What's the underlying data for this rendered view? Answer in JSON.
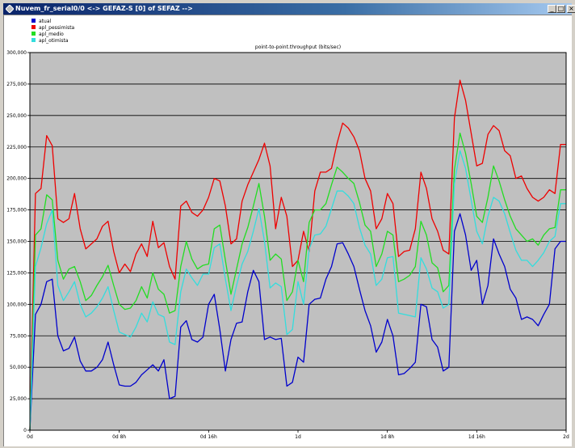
{
  "window": {
    "title": "Nuvem_fr_serial0/0 <-> GEFAZ-S [0] of SEFAZ -->",
    "minimize_icon": "minimize-icon",
    "maximize_icon": "maximize-icon",
    "close_icon": "close-icon"
  },
  "chart_data": {
    "type": "line",
    "title": "point-to-point.throughput (bits/sec)",
    "ylim": [
      0,
      300000
    ],
    "xlim": [
      0,
      96
    ],
    "y_ticks": [
      {
        "value": 0,
        "label": "0"
      },
      {
        "value": 25000,
        "label": "25,000"
      },
      {
        "value": 50000,
        "label": "50,000"
      },
      {
        "value": 75000,
        "label": "75,000"
      },
      {
        "value": 100000,
        "label": "100,000"
      },
      {
        "value": 125000,
        "label": "125,000"
      },
      {
        "value": 150000,
        "label": "150,000"
      },
      {
        "value": 175000,
        "label": "175,000"
      },
      {
        "value": 200000,
        "label": "200,000"
      },
      {
        "value": 225000,
        "label": "225,000"
      },
      {
        "value": 250000,
        "label": "250,000"
      },
      {
        "value": 275000,
        "label": "275,000"
      },
      {
        "value": 300000,
        "label": "300,000"
      }
    ],
    "x_ticks": [
      {
        "value": 0,
        "label": "0d"
      },
      {
        "value": 16,
        "label": "0d 8h"
      },
      {
        "value": 32,
        "label": "0d 16h"
      },
      {
        "value": 48,
        "label": "1d"
      },
      {
        "value": 64,
        "label": "1d 8h"
      },
      {
        "value": 80,
        "label": "1d 16h"
      },
      {
        "value": 96,
        "label": "2d"
      }
    ],
    "grid": true,
    "legend_position": "top-left",
    "x": [
      0,
      1,
      2,
      3,
      4,
      5,
      6,
      7,
      8,
      9,
      10,
      11,
      12,
      13,
      14,
      15,
      16,
      17,
      18,
      19,
      20,
      21,
      22,
      23,
      24,
      25,
      26,
      27,
      28,
      29,
      30,
      31,
      32,
      33,
      34,
      35,
      36,
      37,
      38,
      39,
      40,
      41,
      42,
      43,
      44,
      45,
      46,
      47,
      48,
      49,
      50,
      51,
      52,
      53,
      54,
      55,
      56,
      57,
      58,
      59,
      60,
      61,
      62,
      63,
      64,
      65,
      66,
      67,
      68,
      69,
      70,
      71,
      72,
      73,
      74,
      75,
      76,
      77,
      78,
      79,
      80,
      81,
      82,
      83,
      84,
      85,
      86,
      87,
      88,
      89,
      90,
      91,
      92,
      93,
      94,
      95,
      96
    ],
    "series": [
      {
        "name": "atual",
        "color": "#0000cc",
        "values": [
          0,
          92000,
          100000,
          118000,
          120000,
          75000,
          63000,
          65000,
          74000,
          55000,
          47000,
          47000,
          50000,
          56000,
          70000,
          52000,
          36000,
          35000,
          35000,
          38000,
          44000,
          48000,
          52000,
          47000,
          56000,
          25000,
          27000,
          82000,
          87000,
          72000,
          70000,
          74000,
          100000,
          108000,
          80000,
          47000,
          72000,
          85000,
          86000,
          110000,
          127000,
          118000,
          72000,
          74000,
          72000,
          73000,
          35000,
          38000,
          58000,
          54000,
          100000,
          104000,
          105000,
          120000,
          130000,
          148000,
          149000,
          140000,
          130000,
          112000,
          95000,
          83000,
          62000,
          70000,
          88000,
          75000,
          44000,
          45000,
          49000,
          54000,
          100000,
          98000,
          72000,
          66000,
          47000,
          50000,
          158000,
          172000,
          155000,
          127000,
          135000,
          100000,
          115000,
          152000,
          140000,
          130000,
          112000,
          105000,
          88000,
          90000,
          88000,
          83000,
          92000,
          100000,
          144000,
          150000,
          150000
        ]
      },
      {
        "name": "apl_pessimista",
        "color": "#ee0000",
        "values": [
          0,
          188000,
          192000,
          234000,
          226000,
          168000,
          165000,
          168000,
          188000,
          160000,
          144000,
          148000,
          152000,
          162000,
          166000,
          142000,
          125000,
          132000,
          126000,
          140000,
          148000,
          138000,
          166000,
          145000,
          149000,
          130000,
          120000,
          178000,
          182000,
          173000,
          170000,
          175000,
          185000,
          200000,
          198000,
          178000,
          148000,
          152000,
          182000,
          195000,
          205000,
          215000,
          228000,
          210000,
          160000,
          185000,
          170000,
          130000,
          135000,
          158000,
          142000,
          190000,
          205000,
          205000,
          208000,
          228000,
          244000,
          240000,
          233000,
          222000,
          200000,
          190000,
          160000,
          168000,
          188000,
          180000,
          138000,
          142000,
          143000,
          160000,
          205000,
          192000,
          168000,
          158000,
          143000,
          140000,
          248000,
          278000,
          262000,
          236000,
          210000,
          212000,
          235000,
          242000,
          238000,
          222000,
          218000,
          200000,
          202000,
          192000,
          185000,
          182000,
          185000,
          191000,
          188000,
          227000,
          227000
        ]
      },
      {
        "name": "apl_medio",
        "color": "#22dd22",
        "values": [
          0,
          155000,
          160000,
          187000,
          183000,
          135000,
          120000,
          128000,
          130000,
          118000,
          103000,
          107000,
          115000,
          122000,
          131000,
          115000,
          100000,
          96000,
          97000,
          103000,
          114000,
          105000,
          125000,
          112000,
          108000,
          93000,
          95000,
          130000,
          150000,
          136000,
          128000,
          131000,
          132000,
          160000,
          163000,
          135000,
          108000,
          128000,
          148000,
          161000,
          178000,
          196000,
          170000,
          135000,
          140000,
          136000,
          103000,
          110000,
          135000,
          118000,
          165000,
          175000,
          175000,
          180000,
          195000,
          209000,
          205000,
          200000,
          196000,
          181000,
          163000,
          158000,
          130000,
          140000,
          158000,
          155000,
          118000,
          120000,
          123000,
          130000,
          166000,
          155000,
          133000,
          129000,
          110000,
          115000,
          207000,
          236000,
          220000,
          196000,
          170000,
          165000,
          185000,
          210000,
          198000,
          183000,
          170000,
          160000,
          155000,
          150000,
          152000,
          147000,
          155000,
          160000,
          161000,
          191000,
          191000
        ]
      },
      {
        "name": "apl_otimista",
        "color": "#33dddd",
        "values": [
          0,
          130000,
          145000,
          164000,
          175000,
          115000,
          103000,
          110000,
          118000,
          100000,
          90000,
          93000,
          98000,
          105000,
          114000,
          95000,
          78000,
          76000,
          74000,
          82000,
          93000,
          86000,
          102000,
          92000,
          90000,
          70000,
          68000,
          110000,
          128000,
          121000,
          115000,
          124000,
          124000,
          145000,
          148000,
          120000,
          95000,
          115000,
          132000,
          142000,
          158000,
          176000,
          150000,
          113000,
          117000,
          114000,
          76000,
          80000,
          118000,
          100000,
          144000,
          155000,
          156000,
          162000,
          176000,
          190000,
          190000,
          186000,
          180000,
          161000,
          147000,
          140000,
          115000,
          120000,
          137000,
          138000,
          93000,
          92000,
          91000,
          90000,
          137000,
          128000,
          113000,
          110000,
          97000,
          100000,
          196000,
          222000,
          208000,
          183000,
          158000,
          148000,
          170000,
          185000,
          182000,
          172000,
          157000,
          143000,
          135000,
          135000,
          130000,
          135000,
          141000,
          150000,
          154000,
          180000,
          180000
        ]
      }
    ]
  }
}
